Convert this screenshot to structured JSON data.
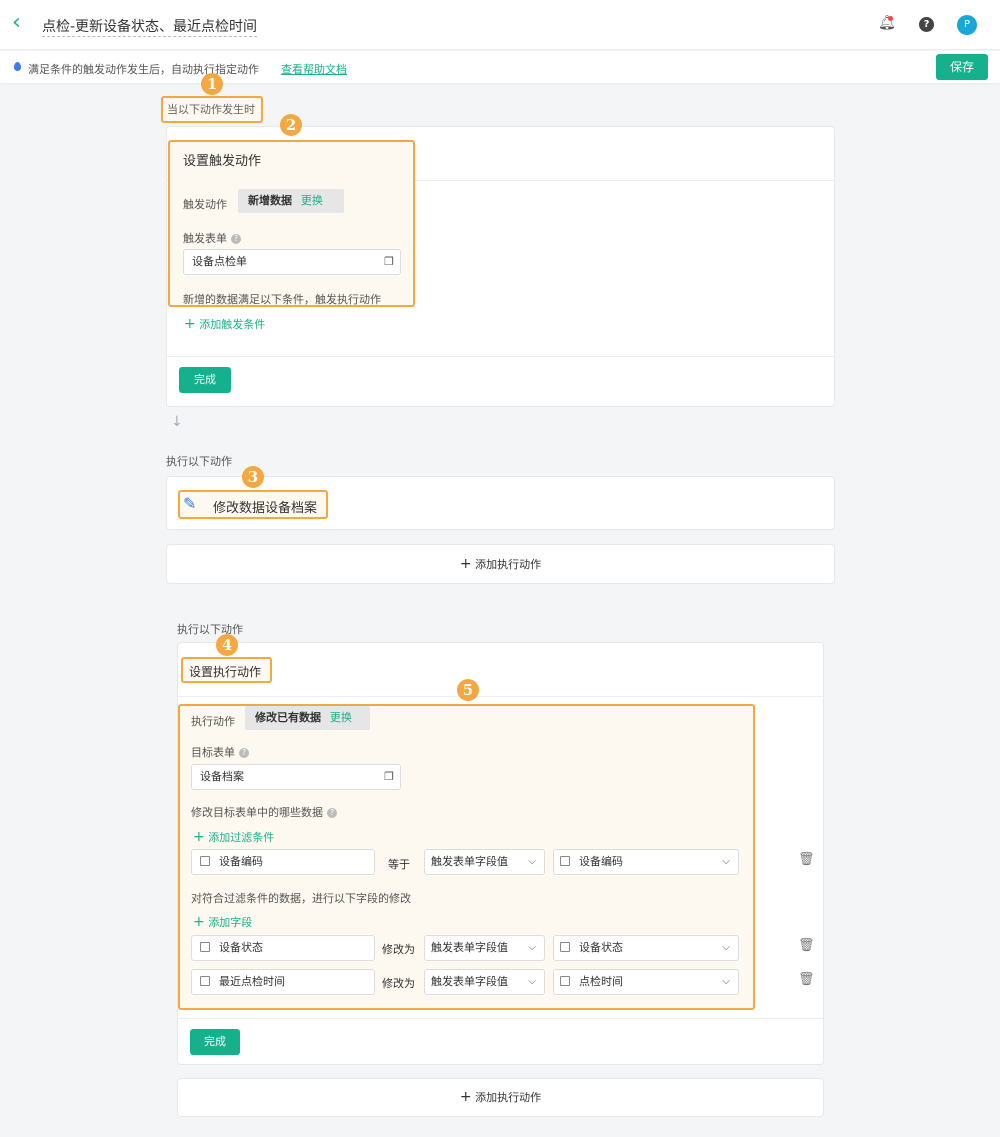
{
  "header": {
    "title": "点检-更新设备状态、最近点检时间",
    "avatar_letter": "P",
    "icons": [
      "back-chevron-icon",
      "bell-icon",
      "help-icon"
    ]
  },
  "infobar": {
    "text": "满足条件的触发动作发生后，自动执行指定动作",
    "help_link": "查看帮助文档",
    "save": "保存"
  },
  "badges": [
    "1",
    "2",
    "3",
    "4",
    "5"
  ],
  "trigger": {
    "section_label": "当以下动作发生时",
    "title": "设置触发动作",
    "action_label": "触发动作",
    "action_value": "新增数据",
    "change": "更换",
    "form_label": "触发表单",
    "form_value": "设备点检单",
    "condition_hint": "新增的数据满足以下条件，触发执行动作",
    "add_condition": "添加触发条件",
    "done": "完成"
  },
  "actions": {
    "section_label": "执行以下动作",
    "item": "修改数据设备档案",
    "add_action": "添加执行动作"
  },
  "exec": {
    "section_label": "执行以下动作",
    "title": "设置执行动作",
    "action_label": "执行动作",
    "action_value": "修改已有数据",
    "change": "更换",
    "target_label": "目标表单",
    "target_value": "设备档案",
    "which_label": "修改目标表单中的哪些数据",
    "add_filter": "添加过滤条件",
    "filter": {
      "field": "设备编码",
      "op": "等于",
      "source": "触发表单字段值",
      "value": "设备编码"
    },
    "modify_hint": "对符合过滤条件的数据，进行以下字段的修改",
    "add_field": "添加字段",
    "rows": [
      {
        "field": "设备状态",
        "op": "修改为",
        "source": "触发表单字段值",
        "value": "设备状态"
      },
      {
        "field": "最近点检时间",
        "op": "修改为",
        "source": "触发表单字段值",
        "value": "点检时间"
      }
    ],
    "done": "完成",
    "add_action": "添加执行动作"
  },
  "colors": {
    "accent": "#15b18c",
    "highlight": "#f5a742"
  }
}
